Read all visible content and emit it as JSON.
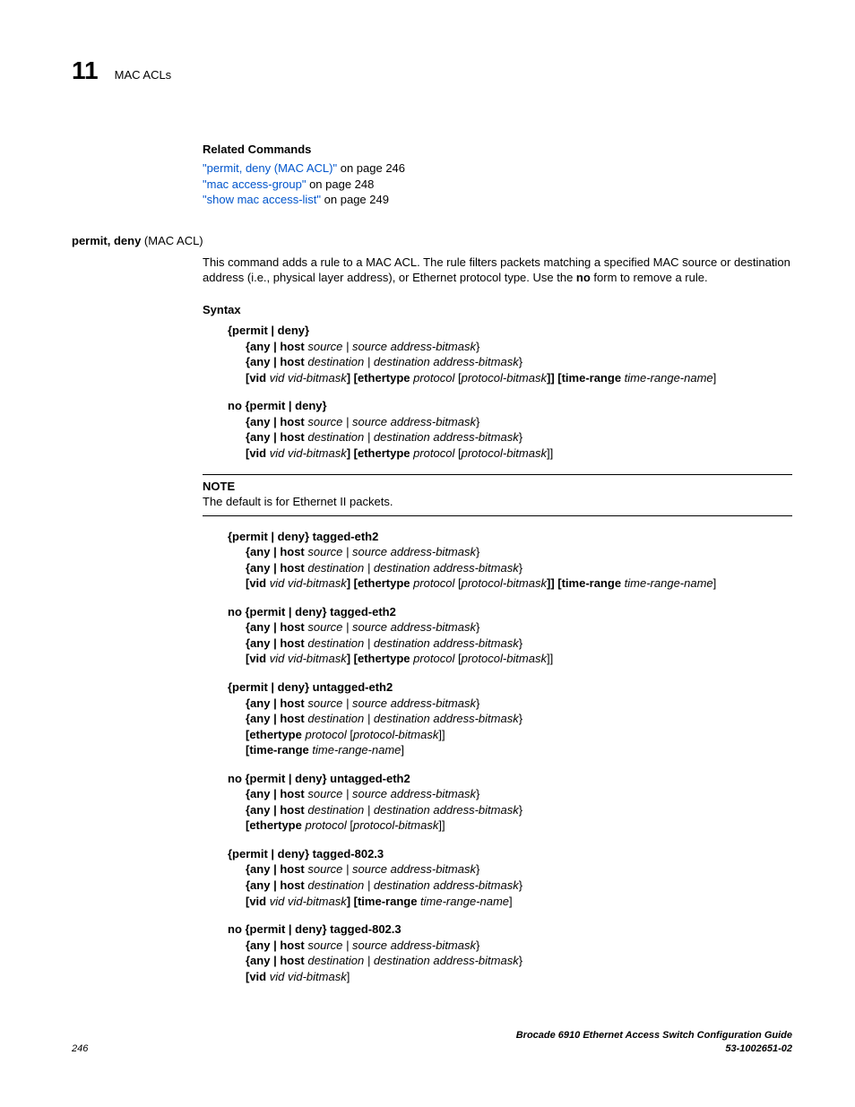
{
  "header": {
    "chapter": "11",
    "title": "MAC ACLs"
  },
  "related": {
    "heading": "Related Commands",
    "link1_text": "\"permit, deny (MAC ACL)\"",
    "link1_suffix": " on page 246",
    "link2_text": "\"mac access-group\"",
    "link2_suffix": " on page 248",
    "link3_text": "\"show mac access-list\"",
    "link3_suffix": " on page 249"
  },
  "cmd": {
    "name": "permit, deny",
    "paren": " (MAC ACL)",
    "desc_pre": "This command adds a rule to a MAC ACL. The rule filters packets matching a specified MAC source or destination address (i.e., physical layer address), or Ethernet protocol type. Use the ",
    "desc_bold": "no",
    "desc_post": " form to remove a rule."
  },
  "syntax_heading": "Syntax",
  "s1": {
    "l1": "{permit | deny}",
    "l2a": "{any | host ",
    "l2b": "source | source address-bitmask",
    "l2c": "}",
    "l3a": "{any | host ",
    "l3b": "destination | destination address-bitmask",
    "l3c": "}",
    "l4a": "[vid ",
    "l4b": "vid vid-bitmask",
    "l4c": "] [ethertype ",
    "l4d": "protocol ",
    "l4e": "[",
    "l4f": "protocol-bitmask",
    "l4g": "]] [time-range ",
    "l4h": "time-range-name",
    "l4i": "]"
  },
  "s2": {
    "l1": "no {permit | deny}",
    "l4a": "[vid ",
    "l4b": "vid vid-bitmask",
    "l4c": "] [ethertype ",
    "l4d": "protocol ",
    "l4e": "[",
    "l4f": "protocol-bitmask",
    "l4g": "]]"
  },
  "note": {
    "label": "NOTE",
    "text": "The default is for Ethernet II packets."
  },
  "s3": {
    "l1a": "{permit | deny}",
    "l1b": " tagged-eth2"
  },
  "s4": {
    "l1a": "no {permit | deny}",
    "l1b": " tagged-eth2"
  },
  "s5": {
    "l1a": "{permit | deny}",
    "l1b": " untagged-eth2",
    "l4a": "[ethertype ",
    "l4b": "protocol ",
    "l4c": "[",
    "l4d": "protocol-bitmask",
    "l4e": "]]",
    "l5a": "[time-range ",
    "l5b": "time-range-name",
    "l5c": "]"
  },
  "s6": {
    "l1a": "no {permit | deny}",
    "l1b": " untagged-eth2"
  },
  "s7": {
    "l1a": "{permit | deny}",
    "l1b": " tagged-802.3",
    "l4a": "[vid ",
    "l4b": "vid vid-bitmask",
    "l4c": "] [time-range ",
    "l4d": "time-range-name",
    "l4e": "]"
  },
  "s8": {
    "l1a": "no {permit | deny}",
    "l1b": " tagged-802.3",
    "l4a": "[vid ",
    "l4b": "vid vid-bitmask",
    "l4c": "]"
  },
  "footer": {
    "page": "246",
    "title": "Brocade 6910 Ethernet Access Switch Configuration Guide",
    "docnum": "53-1002651-02"
  }
}
